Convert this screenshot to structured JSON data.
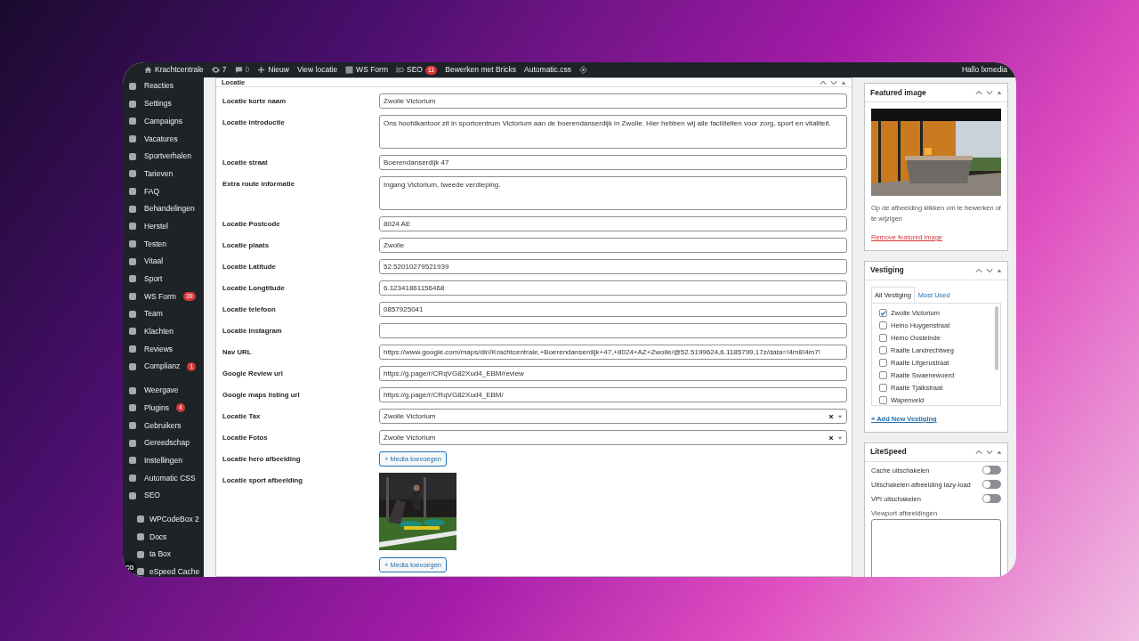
{
  "admin_bar": {
    "items": [
      {
        "kind": "home",
        "label": "Krachtcentrale"
      },
      {
        "kind": "updates",
        "label": "7"
      },
      {
        "kind": "comments",
        "label": "0"
      },
      {
        "kind": "new",
        "label": "Nieuw"
      },
      {
        "kind": "link",
        "label": "View locatie"
      },
      {
        "kind": "wsform",
        "label": "WS Form"
      },
      {
        "kind": "seo",
        "label": "SEO",
        "badge": "11"
      },
      {
        "kind": "link",
        "label": "Bewerken met Bricks"
      },
      {
        "kind": "link",
        "label": "Automatic.css"
      },
      {
        "kind": "bricks"
      }
    ],
    "greeting": "Hallo lxmedia"
  },
  "sidebar": {
    "groups": [
      [
        {
          "label": "Reacties"
        },
        {
          "label": "Settings"
        },
        {
          "label": "Campaigns"
        },
        {
          "label": "Vacatures"
        },
        {
          "label": "Sportverhalen"
        },
        {
          "label": "Tarieven"
        },
        {
          "label": "FAQ"
        },
        {
          "label": "Behandelingen"
        },
        {
          "label": "Herstel"
        },
        {
          "label": "Testen"
        },
        {
          "label": "Vitaal"
        },
        {
          "label": "Sport"
        },
        {
          "label": "WS Form",
          "badge": "39"
        },
        {
          "label": "Team"
        },
        {
          "label": "Klachten"
        },
        {
          "label": "Reviews"
        },
        {
          "label": "Complianz",
          "badge": "1"
        }
      ],
      [
        {
          "label": "Weergave"
        },
        {
          "label": "Plugins",
          "badge": "4"
        },
        {
          "label": "Gebruikers"
        },
        {
          "label": "Gereedschap"
        },
        {
          "label": "Instellingen"
        },
        {
          "label": "Automatic CSS"
        },
        {
          "label": "SEO"
        }
      ],
      [
        {
          "label": "WPCodeBox 2"
        },
        {
          "label": "Docs"
        },
        {
          "label": "ta Box"
        },
        {
          "label": "eSpeed Cache"
        }
      ]
    ],
    "overlay_label": "CO"
  },
  "main_box": {
    "title": "Locatie",
    "fields": [
      {
        "kind": "text",
        "label": "Locatie korte naam",
        "value": "Zwolle Victorium"
      },
      {
        "kind": "textarea",
        "label": "Locatie introductie",
        "value": "Ons hoofdkantoor zit in sportcentrum Victorium aan de boerendanserdijk in Zwolle. Hier hebben wij alle faciliteiten voor zorg, sport en vitaliteit."
      },
      {
        "kind": "text",
        "label": "Locatie straat",
        "value": "Boerendanserdijk 47"
      },
      {
        "kind": "textarea",
        "label": "Extra route informatie",
        "value": "Ingang Victorium, tweede verdieping."
      },
      {
        "kind": "text",
        "label": "Locatie Postcode",
        "value": "8024 AE"
      },
      {
        "kind": "text",
        "label": "Locatie plaats",
        "value": "Zwolle"
      },
      {
        "kind": "text",
        "label": "Locatie Latitude",
        "value": "52.52010279521939"
      },
      {
        "kind": "text",
        "label": "Locatie Longtitude",
        "value": "6.12341861156468"
      },
      {
        "kind": "text",
        "label": "Locatie telefoon",
        "value": "0857925041"
      },
      {
        "kind": "text",
        "label": "Locatie Instagram"
      },
      {
        "kind": "text",
        "label": "Nav URL",
        "value": "https://www.google.com/maps/dir//Krachtcentrale,+Boerendanserdijk+47,+8024+AZ+Zwolle/@52.5199624,6.1185799,17z/data=!4m8!4m7!"
      },
      {
        "kind": "text",
        "label": "Google Review url",
        "value": "https://g.page/r/CRqVG82Xud4_EBM/review"
      },
      {
        "kind": "text",
        "label": "Google maps listing url",
        "value": "https://g.page/r/CRqVG82Xud4_EBM/"
      },
      {
        "kind": "select",
        "label": "Locatie Tax",
        "value": "Zwolle Victorium"
      },
      {
        "kind": "select",
        "label": "Locatie Fotos",
        "value": "Zwolle Victorium"
      },
      {
        "kind": "media",
        "label": "Locatie hero afbeelding",
        "button": "+ Media toevoegen"
      },
      {
        "kind": "image_media",
        "label": "Locatie sport afbeelding",
        "button": "+ Media toevoegen"
      }
    ]
  },
  "featured_image": {
    "title": "Featured image",
    "help": "Op de afbeelding klikken om te bewerken of te wijzigen",
    "remove_link": "Remove featured image"
  },
  "vestiging": {
    "title": "Vestiging",
    "tabs": [
      {
        "label": "All Vestiging",
        "selected": true
      },
      {
        "label": "Most Used",
        "selected": false
      }
    ],
    "items": [
      {
        "label": "Zwolle Victorium",
        "checked": true
      },
      {
        "label": "Heino Huygenstraat",
        "checked": false
      },
      {
        "label": "Heino Oosteinde",
        "checked": false
      },
      {
        "label": "Raalte Landrechtweg",
        "checked": false
      },
      {
        "label": "Raalte Lifgerustraat",
        "checked": false
      },
      {
        "label": "Raalte Swaenewoerd",
        "checked": false
      },
      {
        "label": "Raalte Tjalkstraat",
        "checked": false
      },
      {
        "label": "Wapenveld",
        "checked": false
      }
    ],
    "add_link": "+ Add New Vestiging"
  },
  "litespeed": {
    "title": "LiteSpeed",
    "toggles": [
      {
        "label": "Cache uitschakelen",
        "on": false
      },
      {
        "label": "Uitschakelen afbeelding lazy-load",
        "on": false
      },
      {
        "label": "VPI uitschakelen",
        "on": false
      }
    ],
    "textarea_label": "Viewport afbeeldingen"
  }
}
